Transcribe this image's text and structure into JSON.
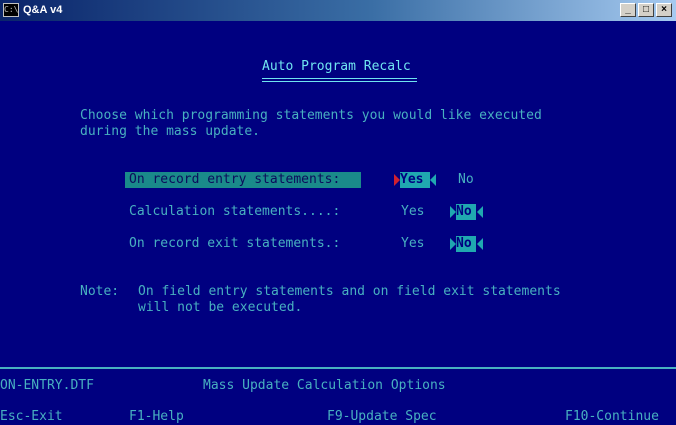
{
  "window": {
    "title": "Q&A v4",
    "icon_glyph": "C:\\",
    "buttons": {
      "minimize": "_",
      "maximize": "□",
      "close": "×"
    }
  },
  "screen": {
    "heading": "Auto Program Recalc",
    "intro_line1": "Choose which programming statements you would like executed",
    "intro_line2": "during the mass update.",
    "options": [
      {
        "label": "On record entry statements:",
        "yes": "Yes",
        "no": "No",
        "selected": "Yes"
      },
      {
        "label": "Calculation statements....:",
        "yes": "Yes",
        "no": "No",
        "selected": "No"
      },
      {
        "label": "On record exit statements.:",
        "yes": "Yes",
        "no": "No",
        "selected": "No"
      }
    ],
    "note_label": "Note:",
    "note_line1": "On field entry statements and on field exit statements",
    "note_line2": "will not be executed."
  },
  "status": {
    "file": "ON-ENTRY.DTF",
    "context": "Mass Update Calculation Options"
  },
  "keys": {
    "esc": "Esc-Exit",
    "f1": "F1-Help",
    "f9": "F9-Update Spec",
    "f10": "F10-Continue"
  },
  "colors": {
    "background": "#000080",
    "text": "#48b0c0",
    "heading": "#70e4f0",
    "highlight": "#20a8b0"
  }
}
